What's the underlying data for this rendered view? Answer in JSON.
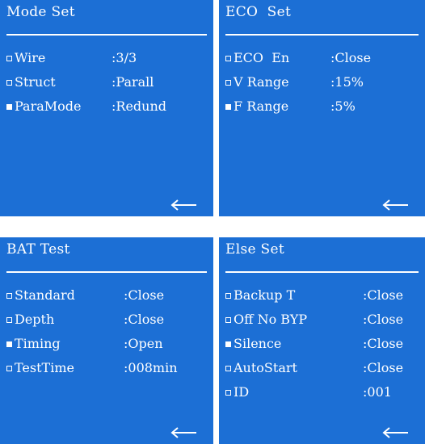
{
  "mode_set": {
    "title": "Mode Set",
    "rows": [
      {
        "label": "Wire",
        "value": ":3/3",
        "selected": false
      },
      {
        "label": "Struct",
        "value": ":Parall",
        "selected": false
      },
      {
        "label": "ParaMode",
        "value": ":Redund",
        "selected": true
      }
    ]
  },
  "eco_set": {
    "title": "ECO  Set",
    "rows": [
      {
        "label": "ECO  En",
        "value": ":Close",
        "selected": false
      },
      {
        "label": "V Range",
        "value": ":15%",
        "selected": false
      },
      {
        "label": "F Range",
        "value": ":5%",
        "selected": true
      }
    ]
  },
  "bat_test": {
    "title": "BAT Test",
    "rows": [
      {
        "label": "Standard",
        "value": ":Close",
        "selected": false
      },
      {
        "label": "Depth",
        "value": ":Close",
        "selected": false
      },
      {
        "label": "Timing",
        "value": ":Open",
        "selected": true
      },
      {
        "label": "TestTime",
        "value": ":008min",
        "selected": false
      }
    ]
  },
  "else_set": {
    "title": "Else Set",
    "rows": [
      {
        "label": "Backup T",
        "value": ":Close",
        "selected": false
      },
      {
        "label": "Off No BYP",
        "value": ":Close",
        "selected": false
      },
      {
        "label": "Silence",
        "value": ":Close",
        "selected": true
      },
      {
        "label": "AutoStart",
        "value": ":Close",
        "selected": false
      },
      {
        "label": "ID",
        "value": ":001",
        "selected": false
      }
    ]
  },
  "icons": {
    "back": "back-arrow-icon"
  },
  "colors": {
    "panel_bg": "#1c6fd5",
    "text": "#ffffff"
  }
}
